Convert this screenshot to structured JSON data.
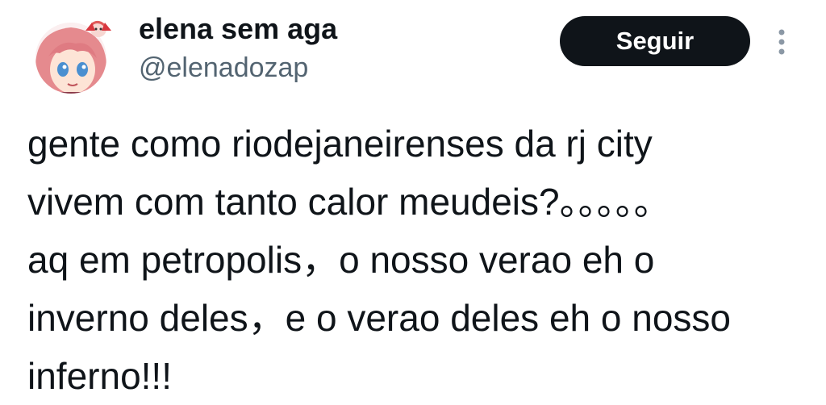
{
  "author": {
    "display_name": "elena sem aga",
    "handle": "@elenadozap",
    "avatar_icon": "anime-girl-avatar"
  },
  "actions": {
    "follow_label": "Seguir",
    "more_icon": "more-vertical-icon"
  },
  "tweet": {
    "lines": [
      "gente como riodejaneirenses da rj city",
      "vivem com tanto calor meudeis?。。。。。",
      "aq em petropolis，o nosso verao eh o",
      "inverno deles，e o verao deles eh o nosso",
      "inferno!!!"
    ]
  },
  "colors": {
    "text": "#0f1419",
    "secondary_text": "#536471",
    "button_bg": "#0f1419",
    "button_text": "#ffffff",
    "background": "#ffffff"
  }
}
